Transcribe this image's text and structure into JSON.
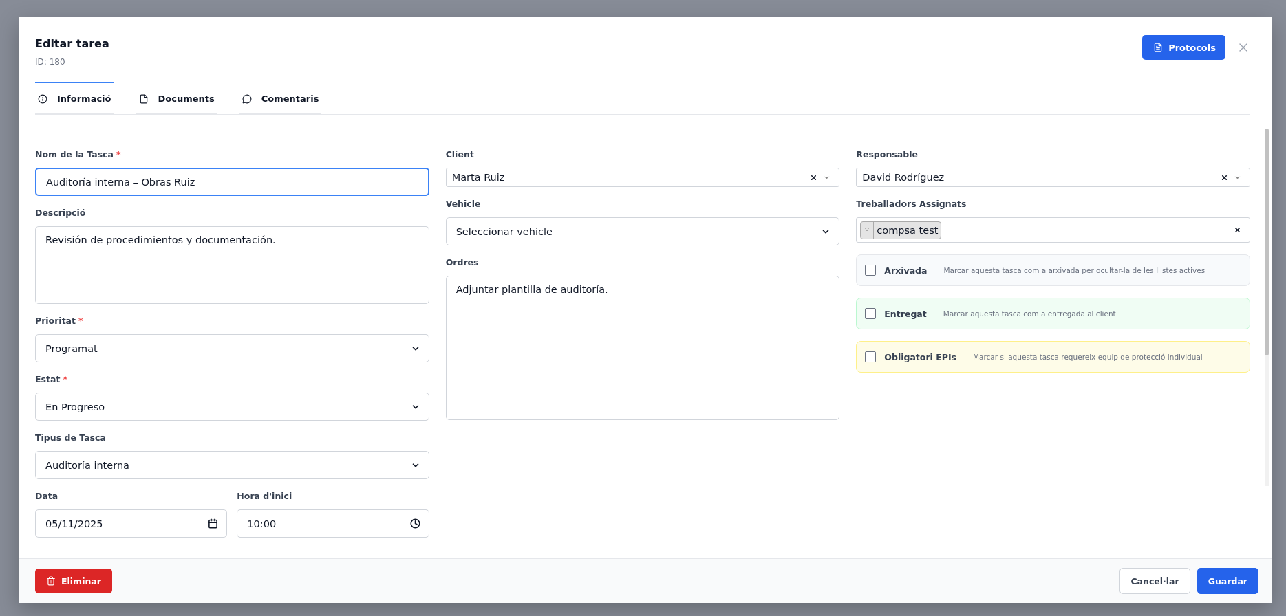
{
  "dialog": {
    "title": "Editar tarea",
    "subtitle": "ID: 180",
    "action": "Protocols"
  },
  "tabs": [
    {
      "label": "Informació",
      "selected": true
    },
    {
      "label": "Documents",
      "selected": false
    },
    {
      "label": "Comentaris",
      "selected": false
    }
  ],
  "columns": [
    [
      {
        "kind": "text",
        "label": "Nom de la Tasca",
        "required_mark": "*",
        "value": "Auditoría interna – Obras Ruiz",
        "focused": true
      },
      {
        "kind": "textarea",
        "label": "Descripció",
        "value": "Revisión de procedimientos y documentación.",
        "focused": false
      },
      {
        "kind": "select",
        "label": "Prioritat",
        "required_mark": "*",
        "value": "Programat",
        "focused": false
      },
      {
        "kind": "select",
        "label": "Estat",
        "required_mark": "*",
        "value": "En Progreso",
        "focused": false
      },
      {
        "kind": "select",
        "label": "Tipus de Tasca",
        "value": "Auditoría interna",
        "focused": false
      },
      {
        "kind": "pair",
        "items": [
          {
            "kind": "date",
            "label": "Data",
            "value": "05/11/2025",
            "focused": false
          },
          {
            "kind": "time",
            "label": "Hora d'inici",
            "value": "10:00",
            "focused": false
          }
        ]
      }
    ],
    [
      {
        "kind": "combo",
        "label": "Client",
        "value": "Marta Ruiz",
        "focused": false
      },
      {
        "kind": "select",
        "label": "Vehicle",
        "value": "Seleccionar vehicle",
        "focused": false
      },
      {
        "kind": "textarea",
        "label": "Ordres",
        "value": "Adjuntar plantilla de auditoría.",
        "focused": false
      }
    ],
    [
      {
        "kind": "combo",
        "label": "Responsable",
        "value": "David Rodríguez",
        "focused": false
      },
      {
        "kind": "tags",
        "label": "Treballadors Assignats",
        "tags": [
          "compsa test"
        ],
        "focused": false
      },
      {
        "kind": "check",
        "label": "Arxivada",
        "hint": "Marcar aquesta tasca com a arxivada per ocultar-la de les llistes actives",
        "checked": false,
        "color": "#f8fafc"
      },
      {
        "kind": "check",
        "label": "Entregat",
        "hint": "Marcar aquesta tasca com a entregada al client",
        "checked": false,
        "color": "#f0fdf4"
      },
      {
        "kind": "check",
        "label": "Obligatori EPIs",
        "hint": "Marcar si aquesta tasca requereix equip de protecció individual",
        "checked": false,
        "color": "#fefce8"
      }
    ]
  ],
  "footer": {
    "delete": "Eliminar",
    "cancel": "Cancel·lar",
    "save": "Guardar"
  }
}
